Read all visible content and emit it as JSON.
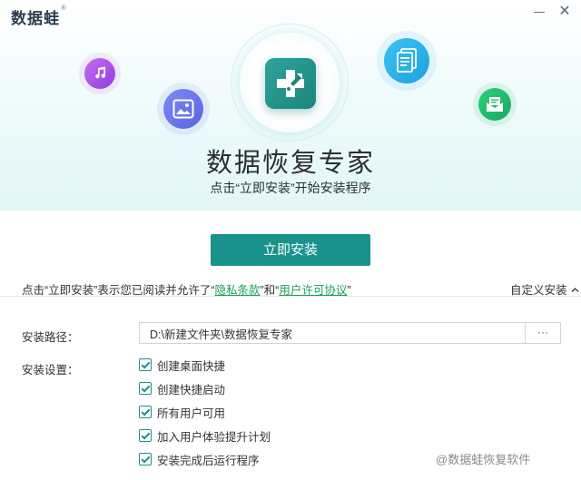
{
  "header": {
    "logo": "数据蛙",
    "logo_mark": "®",
    "minimize_icon": "minimize-icon",
    "close_icon": "close-icon",
    "close_glyph": "✕"
  },
  "hero": {
    "title": "数据恢复专家",
    "subtitle": "点击“立即安装”开始安装程序",
    "icons": [
      "music-icon",
      "image-icon",
      "document-icon",
      "mail-icon",
      "app-logo-icon"
    ]
  },
  "install": {
    "button_label": "立即安装"
  },
  "agreement": {
    "prefix": "点击“立即安装”表示您已阅读并允许了“",
    "privacy": "隐私条款",
    "middle": "”和“",
    "license": "用户许可协议",
    "suffix": "”",
    "custom_install": "自定义安装"
  },
  "settings": {
    "path_label": "安装路径：",
    "path_value": "D:\\新建文件夹\\数据恢复专家",
    "browse_label": "···",
    "settings_label": "安装设置：",
    "options": [
      {
        "label": "创建桌面快捷",
        "checked": true
      },
      {
        "label": "创建快捷启动",
        "checked": true
      },
      {
        "label": "所有用户可用",
        "checked": true
      },
      {
        "label": "加入用户体验提升计划",
        "checked": true
      },
      {
        "label": "安装完成后运行程序",
        "checked": true
      }
    ]
  },
  "watermark": "@数据蛙恢复软件",
  "colors": {
    "accent": "#19928c",
    "link": "#18a05a"
  }
}
